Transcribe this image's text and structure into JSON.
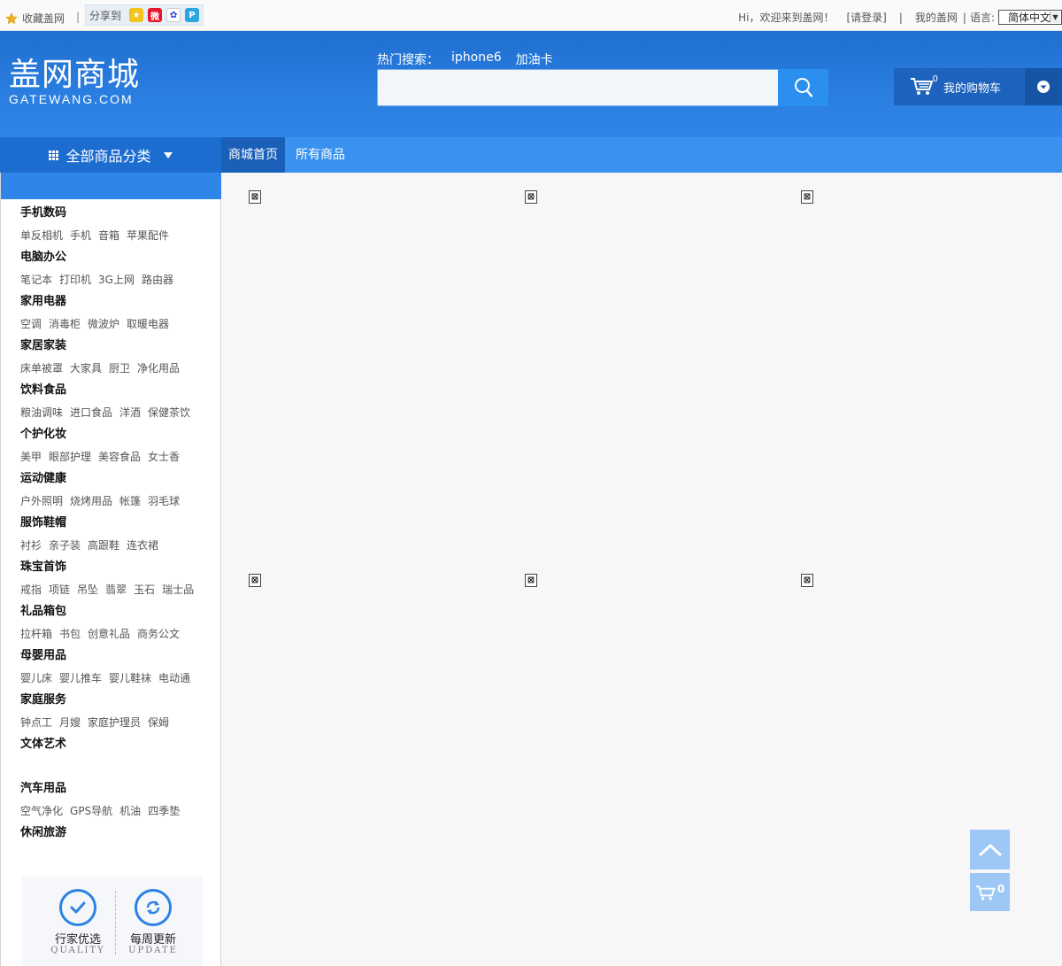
{
  "topbar": {
    "favorite": "收藏盖网",
    "separator": "|",
    "share_label": "分享到",
    "share_icons": [
      "qzone-icon",
      "weibo-icon",
      "baidu-icon",
      "pengyou-icon"
    ],
    "greeting": "Hi，欢迎来到盖网！",
    "login": "[请登录]",
    "separator2": "|",
    "my_account": "我的盖网",
    "separator3": "|",
    "language_label": "语言:",
    "language_value": "简体中文"
  },
  "header": {
    "logo_cn": "盖网商城",
    "logo_en": "GATEWANG.COM",
    "hot_label": "热门搜索：",
    "hot_terms": [
      "iphone6",
      "加油卡"
    ],
    "search_placeholder": "",
    "cart_count": "0",
    "cart_label": "我的购物车"
  },
  "nav": {
    "all_categories": "全部商品分类",
    "links": [
      "商城首页",
      "所有商品"
    ]
  },
  "categories": [
    {
      "title": "手机数码",
      "subs": [
        "单反相机",
        "手机",
        "音箱",
        "苹果配件"
      ]
    },
    {
      "title": "电脑办公",
      "subs": [
        "笔记本",
        "打印机",
        "3G上网",
        "路由器"
      ]
    },
    {
      "title": "家用电器",
      "subs": [
        "空调",
        "消毒柜",
        "微波炉",
        "取暖电器"
      ]
    },
    {
      "title": "家居家装",
      "subs": [
        "床单被罩",
        "大家具",
        "厨卫",
        "净化用品"
      ]
    },
    {
      "title": "饮料食品",
      "subs": [
        "粮油调味",
        "进口食品",
        "洋酒",
        "保健茶饮"
      ]
    },
    {
      "title": "个护化妆",
      "subs": [
        "美甲",
        "眼部护理",
        "美容食品",
        "女士香"
      ]
    },
    {
      "title": "运动健康",
      "subs": [
        "户外照明",
        "烧烤用品",
        "帐篷",
        "羽毛球"
      ]
    },
    {
      "title": "服饰鞋帽",
      "subs": [
        "衬衫",
        "亲子装",
        "高跟鞋",
        "连衣裙"
      ]
    },
    {
      "title": "珠宝首饰",
      "subs": [
        "戒指",
        "项链",
        "吊坠",
        "翡翠",
        "玉石",
        "瑞士品"
      ]
    },
    {
      "title": "礼品箱包",
      "subs": [
        "拉杆箱",
        "书包",
        "创意礼品",
        "商务公文"
      ]
    },
    {
      "title": "母婴用品",
      "subs": [
        "婴儿床",
        "婴儿推车",
        "婴儿鞋袜",
        "电动通"
      ]
    },
    {
      "title": "家庭服务",
      "subs": [
        "钟点工",
        "月嫂",
        "家庭护理员",
        "保姆"
      ]
    },
    {
      "title": "文体艺术",
      "subs": []
    },
    {
      "title": "汽车用品",
      "subs": [
        "空气净化",
        "GPS导航",
        "机油",
        "四季垫"
      ]
    },
    {
      "title": "休闲旅游",
      "subs": null
    }
  ],
  "badges": [
    {
      "title": "行家优选",
      "en": "QUALITY",
      "icon": "check-icon"
    },
    {
      "title": "每周更新",
      "en": "UPDATE",
      "icon": "refresh-icon"
    }
  ],
  "main": {
    "broken_image_glyph": "⊠"
  },
  "float": {
    "cart_count": "0"
  },
  "colors": {
    "brand_blue": "#1f6fd0",
    "nav_blue": "#3a92f0",
    "accent_blue": "#2c83e4"
  }
}
